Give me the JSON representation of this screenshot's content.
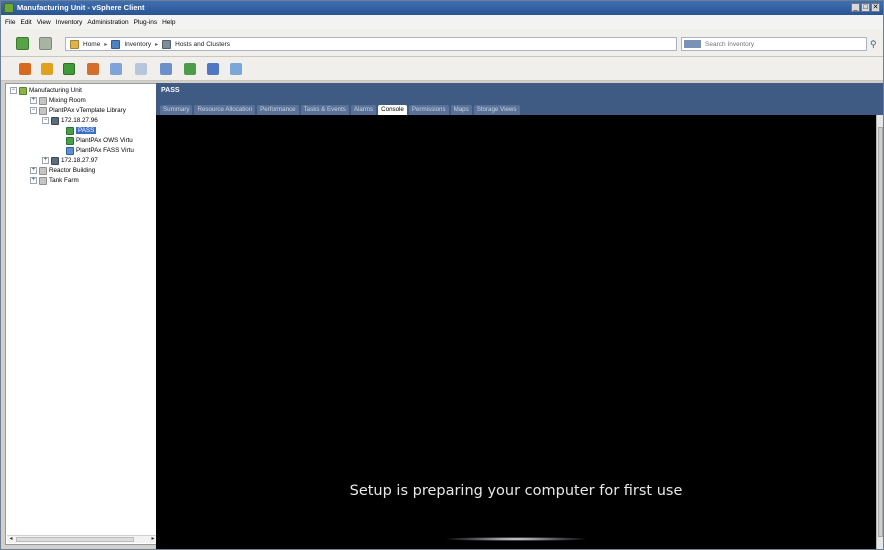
{
  "window": {
    "title": "Manufacturing Unit - vSphere Client",
    "controls": [
      "_",
      "□",
      "✕"
    ]
  },
  "menu": [
    "File",
    "Edit",
    "View",
    "Inventory",
    "Administration",
    "Plug-ins",
    "Help"
  ],
  "breadcrumb": [
    "Home",
    "Inventory",
    "Hosts and Clusters"
  ],
  "search": {
    "placeholder": "Search Inventory"
  },
  "tree": {
    "root": "Manufacturing Unit",
    "mixing_room": "Mixing Room",
    "template_library": "PlantPAx vTemplate Library",
    "host1": "172.18.27.96",
    "vm_pass": "PASS",
    "vm_ows": "PlantPAx OWS Virtu",
    "vm_fass": "PlantPAx FASS Virtu",
    "host2": "172.18.27.97",
    "reactor": "Reactor Building",
    "tank": "Tank Farm"
  },
  "panel": {
    "title": "PASS",
    "tabs": [
      "Summary",
      "Resource Allocation",
      "Performance",
      "Tasks & Events",
      "Alarms",
      "Console",
      "Permissions",
      "Maps",
      "Storage Views"
    ],
    "active_tab": "Console"
  },
  "console": {
    "message": "Setup is preparing your computer for first use"
  }
}
